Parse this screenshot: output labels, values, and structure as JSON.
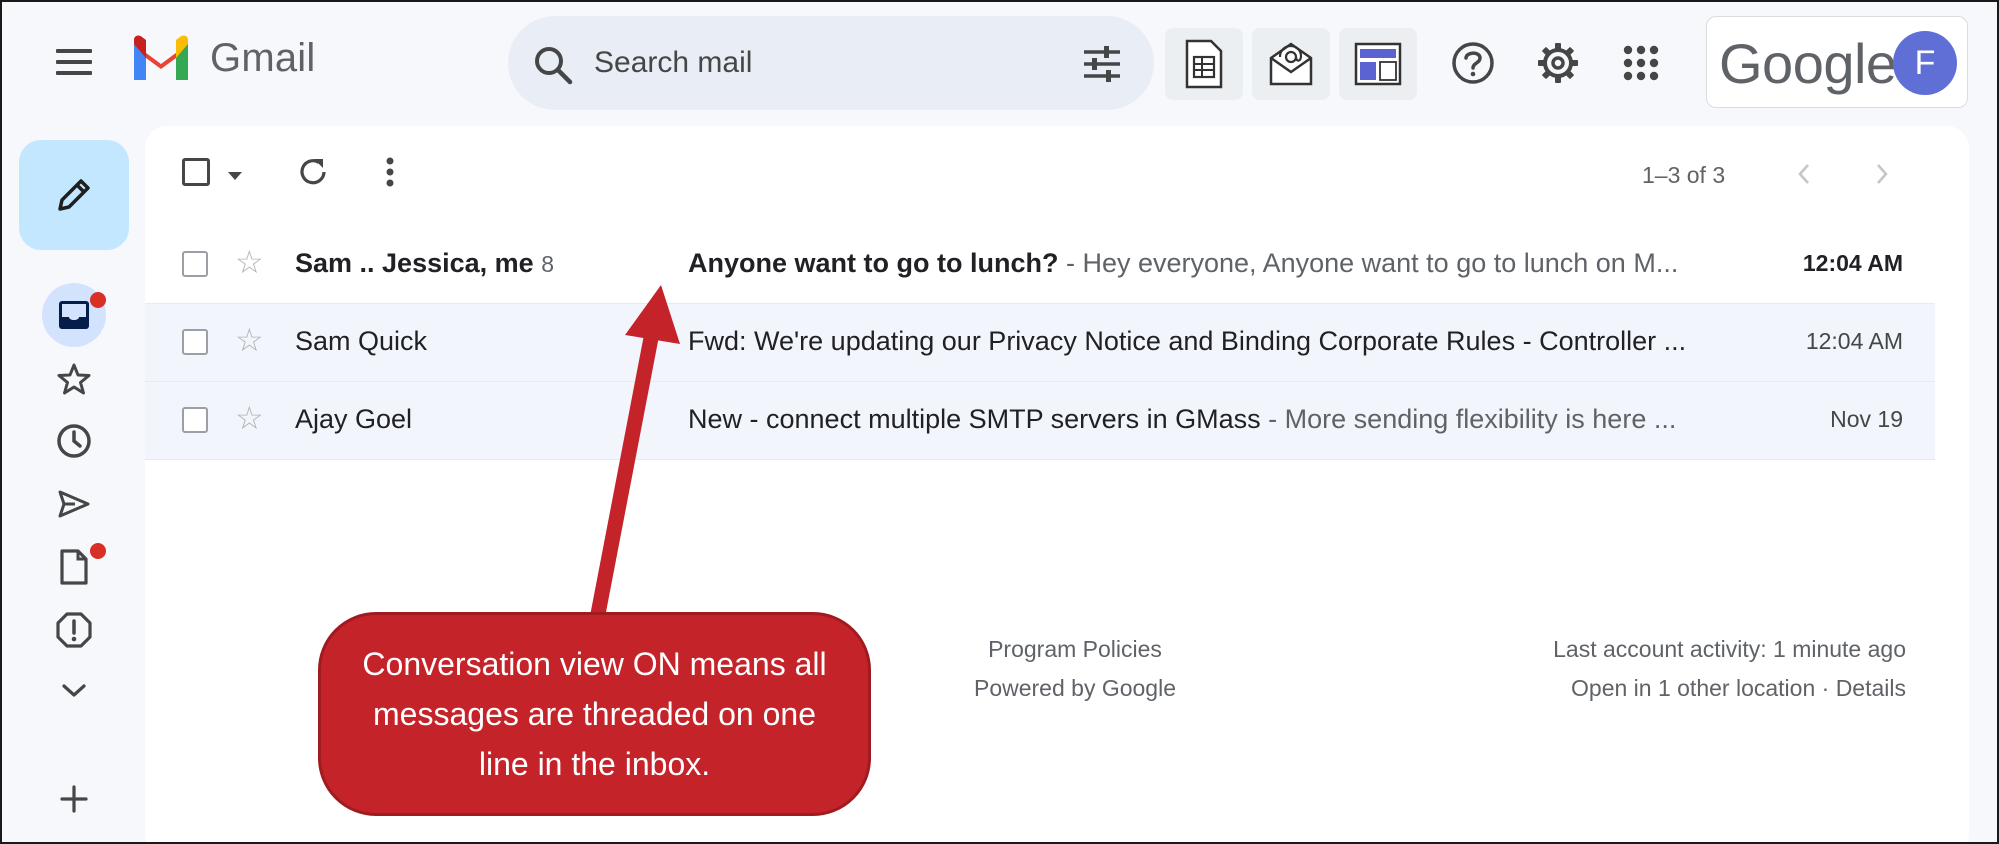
{
  "app": {
    "name": "Gmail"
  },
  "header": {
    "search_placeholder": "Search mail",
    "account_brand": "Google",
    "avatar_initial": "F"
  },
  "toolbar": {
    "pager": "1–3 of 3"
  },
  "emails": [
    {
      "sender": "Sam .. Jessica, me",
      "count": "8",
      "subject": "Anyone want to go to lunch?",
      "snippet": " - Hey everyone, Anyone want to go to lunch on M...",
      "time": "12:04 AM",
      "unread": true
    },
    {
      "sender": "Sam Quick",
      "count": "",
      "subject": "Fwd: We're updating our Privacy Notice and Binding Corporate Rules - Controller ...",
      "snippet": "",
      "time": "12:04 AM",
      "unread": false
    },
    {
      "sender": "Ajay Goel",
      "count": "",
      "subject": "New - connect multiple SMTP servers in GMass",
      "snippet": " - More sending flexibility is here  ...",
      "time": "Nov 19",
      "unread": false
    }
  ],
  "footer": {
    "program_policies": "Program Policies",
    "powered_by": "Powered by Google",
    "last_activity": "Last account activity: 1 minute ago",
    "other_location": "Open in 1 other location",
    "separator": " · ",
    "details": "Details"
  },
  "annotation": {
    "callout_text": "Conversation view ON means all messages are threaded on one line in the inbox.",
    "color": "#c5232a"
  },
  "colors": {
    "compose_bg": "#c2e7ff",
    "search_bg": "#e9eef6",
    "read_row_bg": "#f2f6fc",
    "badge_red": "#d93025",
    "avatar_bg": "#5f6fd6"
  }
}
